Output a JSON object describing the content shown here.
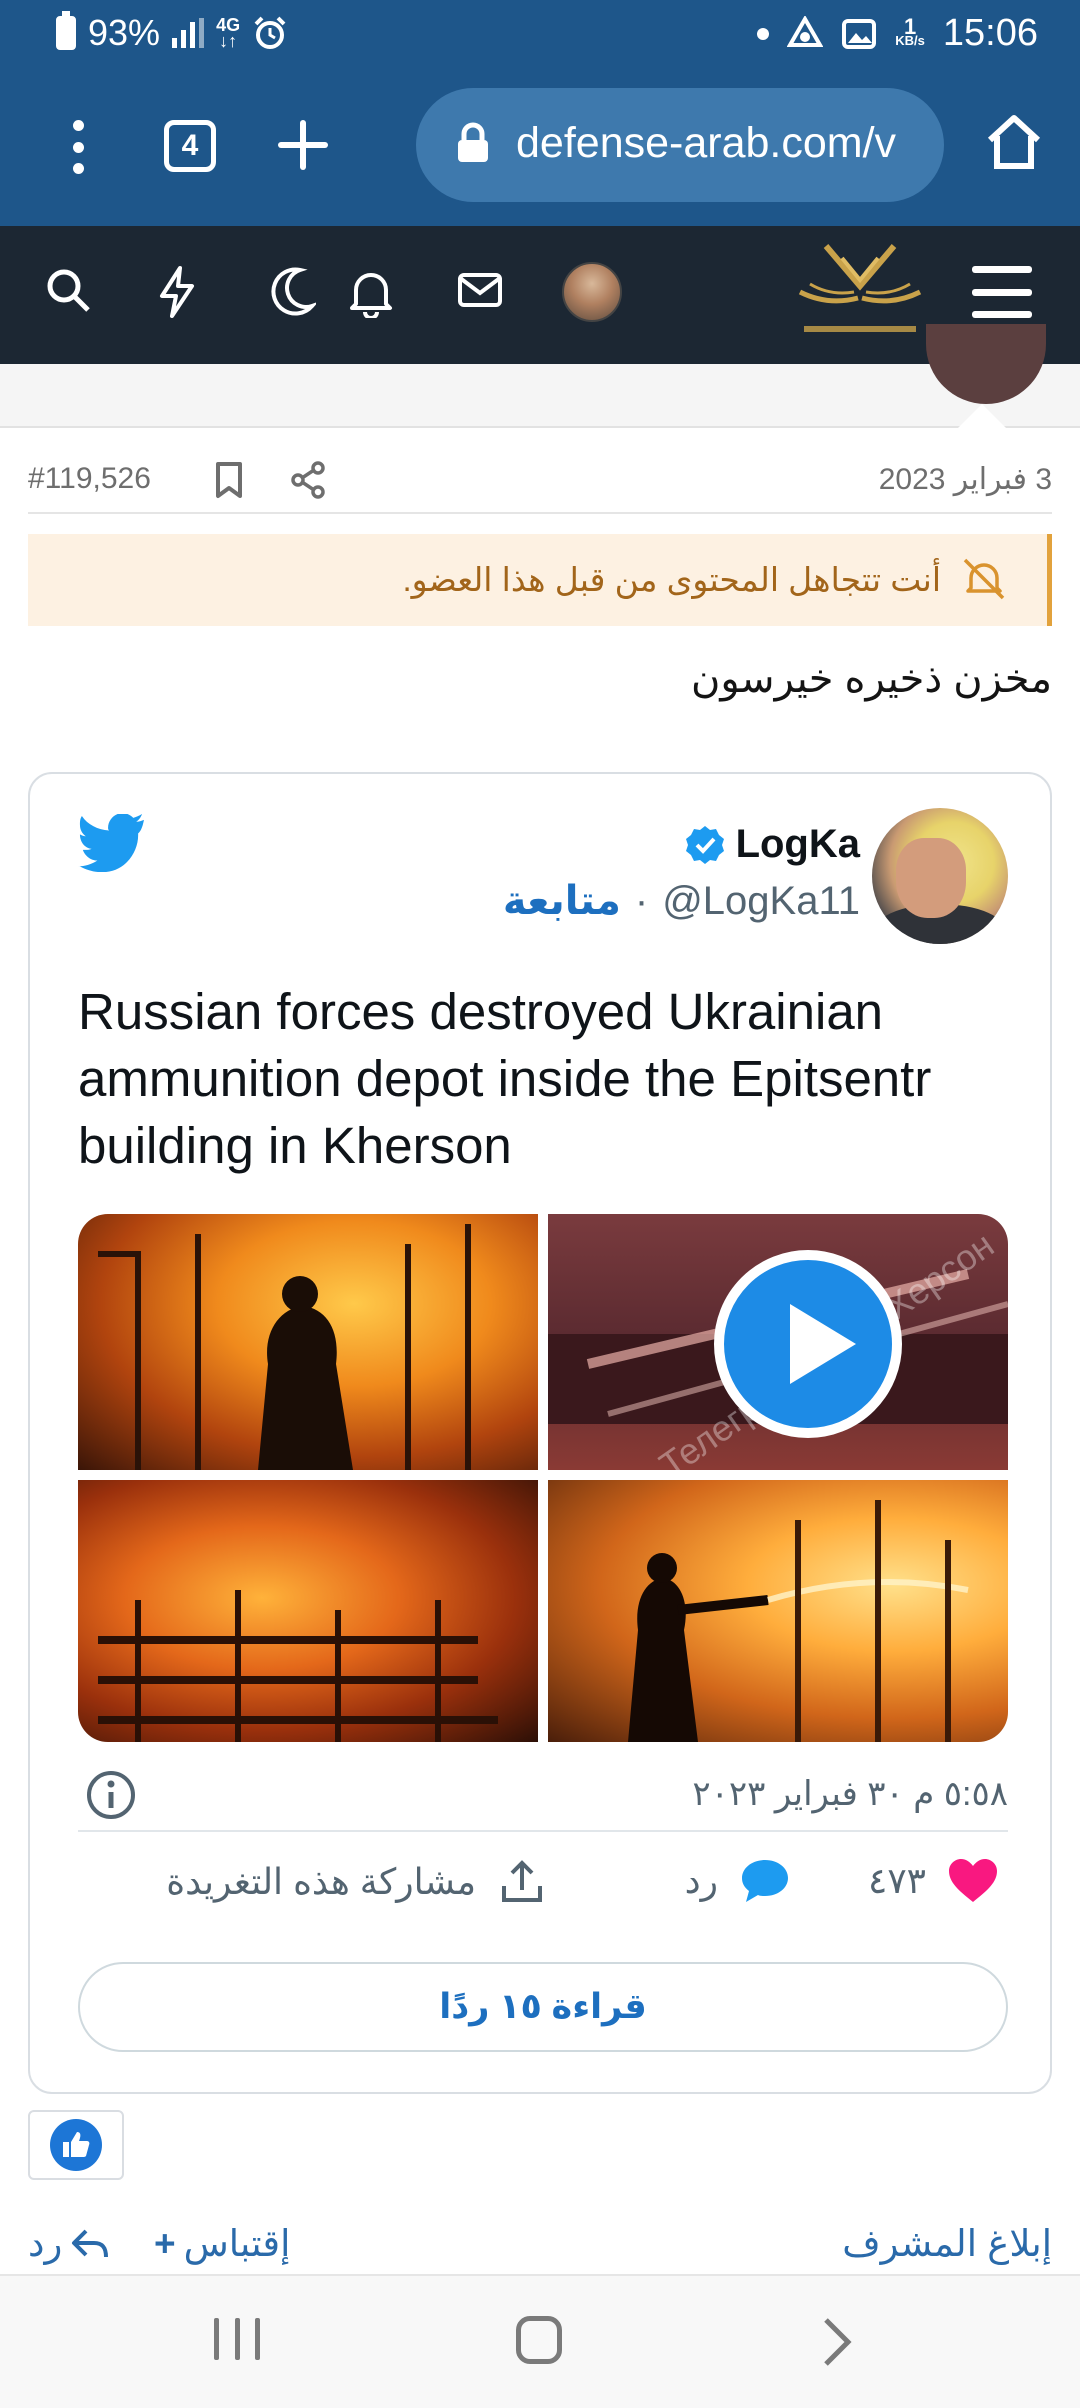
{
  "status_bar": {
    "battery": "93%",
    "network": "4G",
    "speed_value": "1",
    "speed_unit": "KB/s",
    "time": "15:06"
  },
  "browser": {
    "tab_count": "4",
    "url": "defense-arab.com/v"
  },
  "post": {
    "number": "#119,526",
    "date": "3 فبراير 2023",
    "ignore_notice": "أنت تتجاهل المحتوى من قبل هذا العضو.",
    "body_text": "مخزن ذخيره خيرسون"
  },
  "tweet": {
    "author_name": "LogKa",
    "handle": "@LogKa11",
    "separator": "·",
    "follow_label": "متابعة",
    "text": "Russian forces destroyed Ukrainian ammunition depot inside the Epitsentr building in Kherson",
    "timestamp": "٥:٥٨ م ٣٠ فبراير ٢٠٢٣",
    "like_count": "٤٧٣",
    "reply_label": "رد",
    "share_label": "مشاركة هذه التغريدة",
    "read_replies_label": "قراءة ١٥ ردًا",
    "media_watermark": "Телеграм канал Херсон"
  },
  "footer_actions": {
    "reply_label": "رد",
    "quote_label": "إقتباس",
    "report_label": "إبلاغ المشرف"
  },
  "colors": {
    "browser_blue": "#1e568a",
    "site_header": "#1c2733",
    "link_blue": "#2a6aaa",
    "twitter_blue": "#1d9bf0",
    "like_pink": "#f91880",
    "notice_bg": "#fdf1e2",
    "notice_text": "#a2651a"
  },
  "icons": {
    "status": [
      "battery-icon",
      "signal-icon",
      "alarm-icon",
      "dot-icon",
      "vpn-icon",
      "gallery-icon"
    ],
    "browser": [
      "menu-dots-icon",
      "tab-switcher-icon",
      "new-tab-icon",
      "lock-icon",
      "home-icon"
    ],
    "site_header": [
      "search-icon",
      "lightning-icon",
      "moon-icon",
      "bell-icon",
      "mail-icon",
      "avatar",
      "site-logo",
      "hamburger-icon"
    ],
    "post": [
      "bookmark-icon",
      "share-icon",
      "mute-icon"
    ],
    "tweet": [
      "twitter-bird-icon",
      "verified-badge-icon",
      "play-icon",
      "info-icon",
      "heart-icon",
      "reply-bubble-icon",
      "share-upload-icon"
    ],
    "footer": [
      "reply-arrow-icon",
      "plus-icon",
      "thumbs-up-icon"
    ],
    "nav": [
      "recent-apps-icon",
      "home-nav-icon",
      "back-nav-icon"
    ]
  }
}
